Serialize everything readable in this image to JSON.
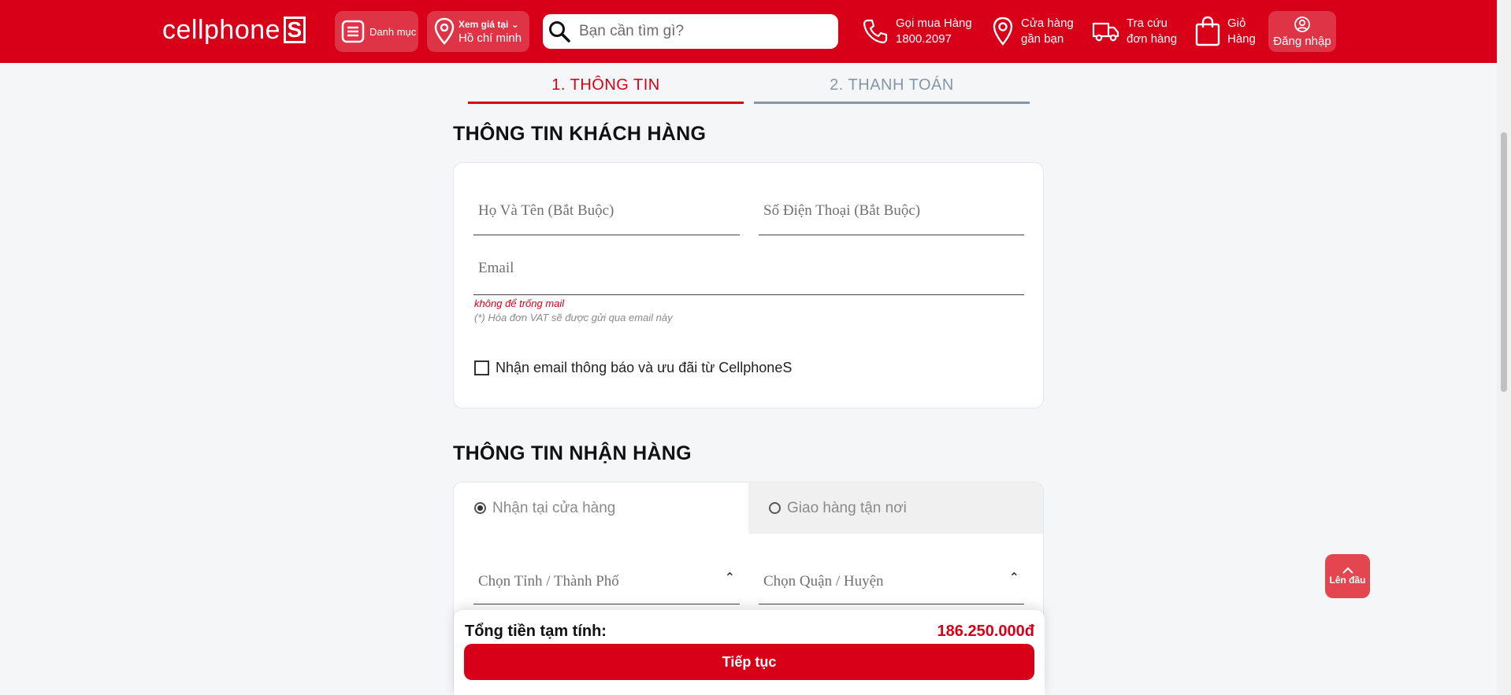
{
  "header": {
    "logo_text": "cellphone",
    "logo_s": "S",
    "category_label": "Danh mục",
    "location_small": "Xem giá tại",
    "location_city": "Hồ chí minh",
    "search_placeholder": "Bạn cần tìm gì?",
    "call_line1": "Gọi mua Hàng",
    "call_line2": "1800.2097",
    "store_line1": "Cửa hàng",
    "store_line2": "gần bạn",
    "track_line1": "Tra cứu",
    "track_line2": "đơn hàng",
    "cart_line1": "Giỏ",
    "cart_line2": "Hàng",
    "login_label": "Đăng nhập"
  },
  "steps": {
    "step1": "1. THÔNG TIN",
    "step2": "2. THANH TOÁN"
  },
  "customer": {
    "title": "THÔNG TIN KHÁCH HÀNG",
    "name_placeholder": "Họ Và Tên (Bắt Buộc)",
    "phone_placeholder": "Số Điện Thoại (Bắt Buộc)",
    "email_placeholder": "Email",
    "email_error": "không để trống mail",
    "email_note": "(*) Hóa đơn VAT sẽ được gửi qua email này",
    "newsletter_label": "Nhận email thông báo và ưu đãi từ CellphoneS"
  },
  "delivery": {
    "title": "THÔNG TIN NHẬN HÀNG",
    "tab_store": "Nhận tại cửa hàng",
    "tab_ship": "Giao hàng tận nơi",
    "city_select": "Chọn Tỉnh / Thành Phố",
    "district_select": "Chọn Quận / Huyện"
  },
  "summary": {
    "total_label": "Tổng tiền tạm tính:",
    "total_value": "186.250.000đ",
    "continue_label": "Tiếp tục"
  },
  "back_to_top": "Lên đầu",
  "colors": {
    "brand_red": "#d70018",
    "inactive_step": "#8796a7",
    "background": "#f4f6f8"
  }
}
